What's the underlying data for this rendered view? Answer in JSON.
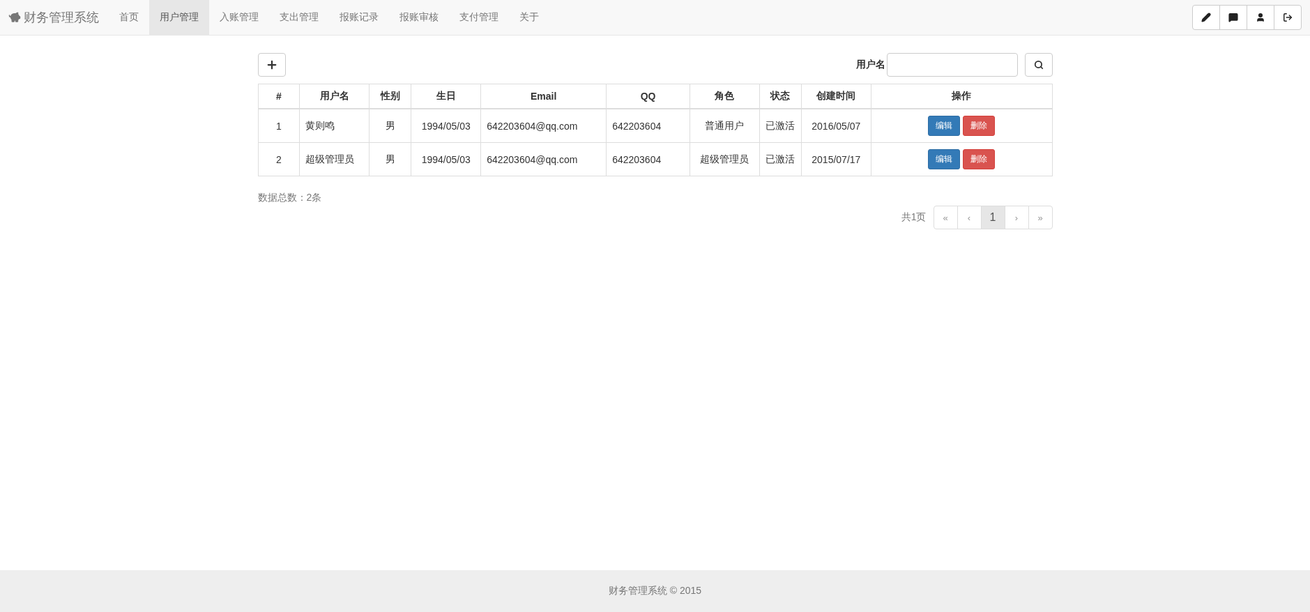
{
  "brand": "财务管理系统",
  "nav": [
    {
      "label": "首页",
      "selected": false
    },
    {
      "label": "用户管理",
      "selected": true
    },
    {
      "label": "入账管理",
      "selected": false
    },
    {
      "label": "支出管理",
      "selected": false
    },
    {
      "label": "报账记录",
      "selected": false
    },
    {
      "label": "报账审核",
      "selected": false
    },
    {
      "label": "支付管理",
      "selected": false
    },
    {
      "label": "关于",
      "selected": false
    }
  ],
  "nav_tools": [
    {
      "kind": "edit"
    },
    {
      "kind": "message"
    },
    {
      "kind": "user"
    },
    {
      "kind": "logout"
    }
  ],
  "search": {
    "label": "用户名"
  },
  "table": {
    "columns": [
      {
        "label": "#"
      },
      {
        "label": "用户名"
      },
      {
        "label": "性别"
      },
      {
        "label": "生日"
      },
      {
        "label": "Email"
      },
      {
        "label": "QQ"
      },
      {
        "label": "角色"
      },
      {
        "label": "状态"
      },
      {
        "label": "创建时间"
      },
      {
        "label": "操作"
      }
    ],
    "rows": [
      {
        "cells": [
          "1",
          "黄则鸣",
          "男",
          "1994/05/03",
          "642203604@qq.com",
          "642203604",
          "普通用户",
          "已激活",
          "2016/05/07"
        ],
        "actions": [
          "编辑",
          "删除"
        ]
      },
      {
        "cells": [
          "2",
          "超级管理员",
          "男",
          "1994/05/03",
          "642203604@qq.com",
          "642203604",
          "超级管理员",
          "已激活",
          "2015/07/17"
        ],
        "actions": [
          "编辑",
          "删除"
        ]
      }
    ]
  },
  "total": "数据总数：2条",
  "pagination": {
    "summary": "共1页",
    "items": [
      {
        "label": "«",
        "selected": false
      },
      {
        "label": "‹",
        "selected": false
      },
      {
        "label": "1",
        "selected": true
      },
      {
        "label": "›",
        "selected": false
      },
      {
        "label": "»",
        "selected": false
      }
    ]
  },
  "footer": "财务管理系统 © 2015"
}
